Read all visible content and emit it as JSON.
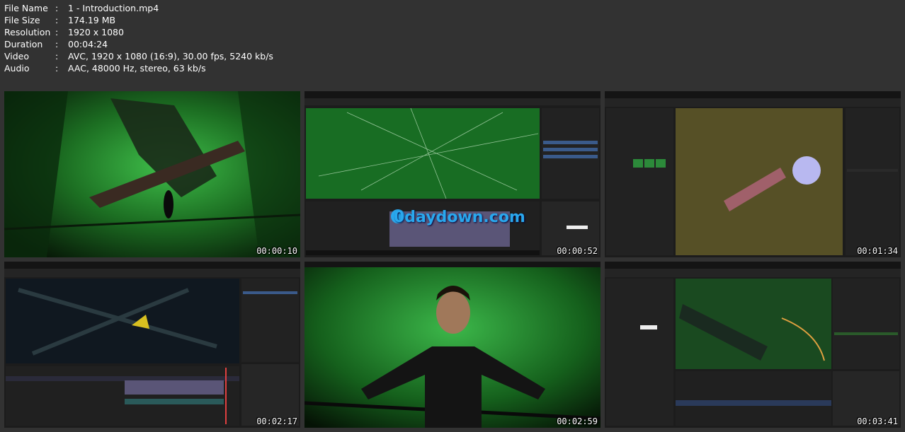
{
  "file_info": [
    {
      "key": "File Name",
      "value": "1 - Introduction.mp4"
    },
    {
      "key": "File Size",
      "value": "174.19 MB"
    },
    {
      "key": "Resolution",
      "value": "1920 x 1080"
    },
    {
      "key": "Duration",
      "value": "00:04:24"
    },
    {
      "key": "Video",
      "value": "AVC, 1920 x 1080 (16:9), 30.00 fps, 5240 kb/s"
    },
    {
      "key": "Audio",
      "value": "AAC, 48000 Hz, stereo, 63 kb/s"
    }
  ],
  "separator": ":",
  "thumbnails": [
    {
      "timestamp": "00:00:10"
    },
    {
      "timestamp": "00:00:52",
      "watermark": "0daydown.com"
    },
    {
      "timestamp": "00:01:34"
    },
    {
      "timestamp": "00:02:17"
    },
    {
      "timestamp": "00:02:59"
    },
    {
      "timestamp": "00:03:41"
    }
  ],
  "colors": {
    "background": "#323232",
    "scene_green": "#1f8a2e",
    "editor_dark": "#1a1a1a",
    "timeline_purple": "#5a5577",
    "accent_blue": "#2a7fd4"
  },
  "icons": [
    "film-strip-icon"
  ]
}
